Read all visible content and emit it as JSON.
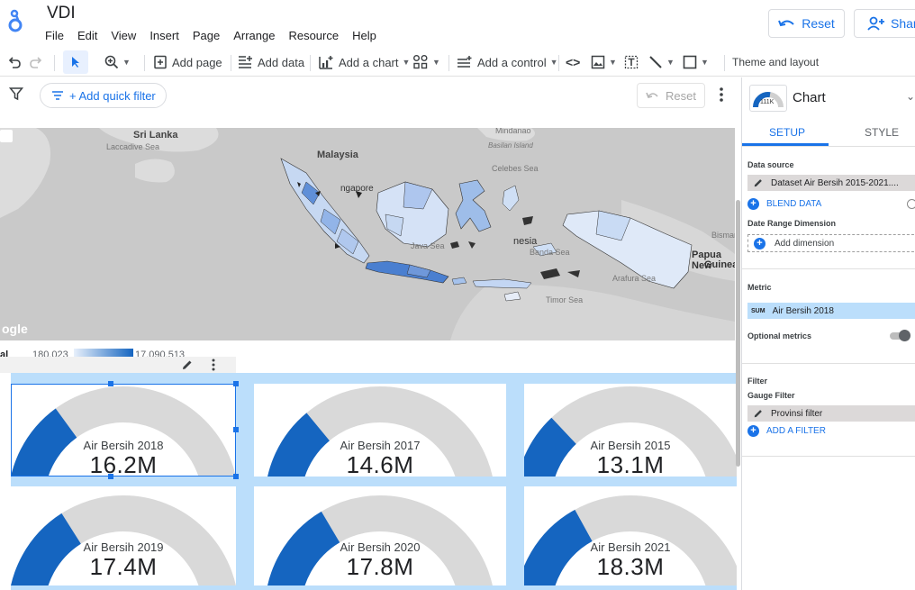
{
  "app": {
    "title": "VDI",
    "menu": [
      "File",
      "Edit",
      "View",
      "Insert",
      "Page",
      "Arrange",
      "Resource",
      "Help"
    ],
    "reset_label": "Reset",
    "share_label": "Share"
  },
  "toolbar": {
    "add_page": "Add page",
    "add_data": "Add data",
    "add_chart": "Add a chart",
    "add_control": "Add a control",
    "theme": "Theme and layout"
  },
  "filterbar": {
    "quick_filter": "+ Add quick filter",
    "reset": "Reset"
  },
  "map": {
    "labels": {
      "sri_lanka": "Sri Lanka",
      "laccadive": "Laccadive Sea",
      "malaysia": "Malaysia",
      "singapore": "ngapore",
      "mindanao": "Mindanao",
      "basilan": "Basilan Island",
      "celebes": "Celebes Sea",
      "java_sea": "Java Sea",
      "indonesia": "nesia",
      "banda": "Banda Sea",
      "bismar": "Bismar",
      "papua": "Papua New",
      "guinea": "Guinea",
      "arafura": "Arafura Sea",
      "timor": "Timor Sea",
      "google": "ogle"
    }
  },
  "legend": {
    "label": "al",
    "min": "180,023",
    "max": "17,090,513"
  },
  "gauges": [
    {
      "label": "Air Bersih 2018",
      "value": "16.2M",
      "fill": 0.3
    },
    {
      "label": "Air Bersih 2017",
      "value": "14.6M",
      "fill": 0.28
    },
    {
      "label": "Air Bersih 2015",
      "value": "13.1M",
      "fill": 0.26
    },
    {
      "label": "Air Bersih 2019",
      "value": "17.4M",
      "fill": 0.32
    },
    {
      "label": "Air Bersih 2020",
      "value": "17.8M",
      "fill": 0.33
    },
    {
      "label": "Air Bersih 2021",
      "value": "18.3M",
      "fill": 0.34
    }
  ],
  "panel": {
    "title": "Chart",
    "icon_badge": "111K",
    "tab_setup": "SETUP",
    "tab_style": "STYLE",
    "data_source_head": "Data source",
    "data_source": "Dataset Air Bersih 2015-2021....",
    "blend_data": "BLEND DATA",
    "date_range_head": "Date Range Dimension",
    "add_dimension": "Add dimension",
    "metric_head": "Metric",
    "metric_agg": "SUM",
    "metric": "Air Bersih 2018",
    "optional_metrics": "Optional metrics",
    "filter_head": "Filter",
    "gauge_filter_head": "Gauge Filter",
    "gauge_filter": "Provinsi filter",
    "add_filter": "ADD A FILTER"
  },
  "colors": {
    "accent": "#1a73e8",
    "gauge_fill": "#1565c0",
    "gauge_track": "#d9d9d9",
    "selection_bg": "#bbdefb"
  }
}
